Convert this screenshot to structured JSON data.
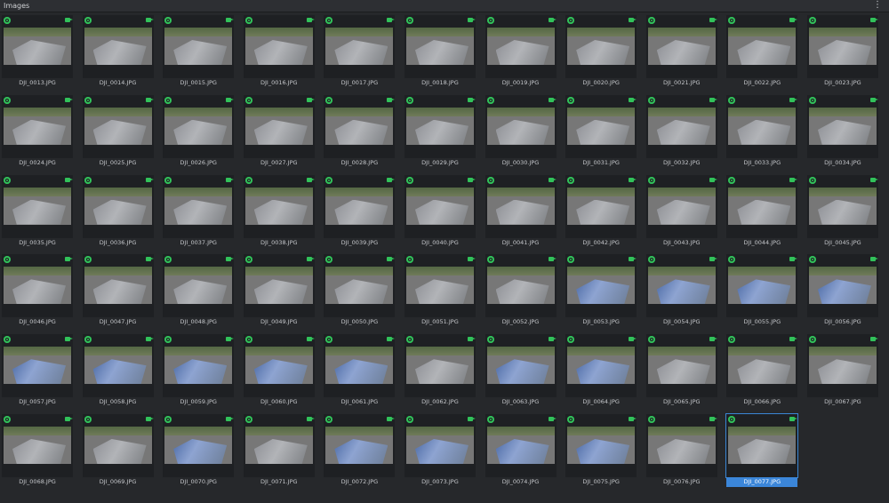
{
  "panel": {
    "title": "Images",
    "menu_icon": "more-vertical-icon",
    "selected_file": "DJI_0077.JPG"
  },
  "images": [
    {
      "label": "DJI_0013.JPG",
      "tone": "gray"
    },
    {
      "label": "DJI_0014.JPG",
      "tone": "gray"
    },
    {
      "label": "DJI_0015.JPG",
      "tone": "gray"
    },
    {
      "label": "DJI_0016.JPG",
      "tone": "gray"
    },
    {
      "label": "DJI_0017.JPG",
      "tone": "gray"
    },
    {
      "label": "DJI_0018.JPG",
      "tone": "gray"
    },
    {
      "label": "DJI_0019.JPG",
      "tone": "gray"
    },
    {
      "label": "DJI_0020.JPG",
      "tone": "gray"
    },
    {
      "label": "DJI_0021.JPG",
      "tone": "gray"
    },
    {
      "label": "DJI_0022.JPG",
      "tone": "gray"
    },
    {
      "label": "DJI_0023.JPG",
      "tone": "gray"
    },
    {
      "label": "DJI_0024.JPG",
      "tone": "gray"
    },
    {
      "label": "DJI_0025.JPG",
      "tone": "gray"
    },
    {
      "label": "DJI_0026.JPG",
      "tone": "gray"
    },
    {
      "label": "DJI_0027.JPG",
      "tone": "gray"
    },
    {
      "label": "DJI_0028.JPG",
      "tone": "gray"
    },
    {
      "label": "DJI_0029.JPG",
      "tone": "gray"
    },
    {
      "label": "DJI_0030.JPG",
      "tone": "gray"
    },
    {
      "label": "DJI_0031.JPG",
      "tone": "gray"
    },
    {
      "label": "DJI_0032.JPG",
      "tone": "gray"
    },
    {
      "label": "DJI_0033.JPG",
      "tone": "gray"
    },
    {
      "label": "DJI_0034.JPG",
      "tone": "gray"
    },
    {
      "label": "DJI_0035.JPG",
      "tone": "gray"
    },
    {
      "label": "DJI_0036.JPG",
      "tone": "gray"
    },
    {
      "label": "DJI_0037.JPG",
      "tone": "gray"
    },
    {
      "label": "DJI_0038.JPG",
      "tone": "gray"
    },
    {
      "label": "DJI_0039.JPG",
      "tone": "gray"
    },
    {
      "label": "DJI_0040.JPG",
      "tone": "gray"
    },
    {
      "label": "DJI_0041.JPG",
      "tone": "gray"
    },
    {
      "label": "DJI_0042.JPG",
      "tone": "gray"
    },
    {
      "label": "DJI_0043.JPG",
      "tone": "gray"
    },
    {
      "label": "DJI_0044.JPG",
      "tone": "gray"
    },
    {
      "label": "DJI_0045.JPG",
      "tone": "gray"
    },
    {
      "label": "DJI_0046.JPG",
      "tone": "gray"
    },
    {
      "label": "DJI_0047.JPG",
      "tone": "gray"
    },
    {
      "label": "DJI_0048.JPG",
      "tone": "gray"
    },
    {
      "label": "DJI_0049.JPG",
      "tone": "gray"
    },
    {
      "label": "DJI_0050.JPG",
      "tone": "gray"
    },
    {
      "label": "DJI_0051.JPG",
      "tone": "gray"
    },
    {
      "label": "DJI_0052.JPG",
      "tone": "gray"
    },
    {
      "label": "DJI_0053.JPG",
      "tone": "blue"
    },
    {
      "label": "DJI_0054.JPG",
      "tone": "blue"
    },
    {
      "label": "DJI_0055.JPG",
      "tone": "blue"
    },
    {
      "label": "DJI_0056.JPG",
      "tone": "blue"
    },
    {
      "label": "DJI_0057.JPG",
      "tone": "blue"
    },
    {
      "label": "DJI_0058.JPG",
      "tone": "blue"
    },
    {
      "label": "DJI_0059.JPG",
      "tone": "blue"
    },
    {
      "label": "DJI_0060.JPG",
      "tone": "blue"
    },
    {
      "label": "DJI_0061.JPG",
      "tone": "blue"
    },
    {
      "label": "DJI_0062.JPG",
      "tone": "gray"
    },
    {
      "label": "DJI_0063.JPG",
      "tone": "blue"
    },
    {
      "label": "DJI_0064.JPG",
      "tone": "blue"
    },
    {
      "label": "DJI_0065.JPG",
      "tone": "gray"
    },
    {
      "label": "DJI_0066.JPG",
      "tone": "gray"
    },
    {
      "label": "DJI_0067.JPG",
      "tone": "gray"
    },
    {
      "label": "DJI_0068.JPG",
      "tone": "gray"
    },
    {
      "label": "DJI_0069.JPG",
      "tone": "gray"
    },
    {
      "label": "DJI_0070.JPG",
      "tone": "blue"
    },
    {
      "label": "DJI_0071.JPG",
      "tone": "gray"
    },
    {
      "label": "DJI_0072.JPG",
      "tone": "blue"
    },
    {
      "label": "DJI_0073.JPG",
      "tone": "blue"
    },
    {
      "label": "DJI_0074.JPG",
      "tone": "blue"
    },
    {
      "label": "DJI_0075.JPG",
      "tone": "blue"
    },
    {
      "label": "DJI_0076.JPG",
      "tone": "gray"
    },
    {
      "label": "DJI_0077.JPG",
      "tone": "gray",
      "selected": true
    }
  ],
  "badges": {
    "left_icon": "gear-icon",
    "right_icon": "video-camera-icon",
    "color": "#31c25a"
  },
  "colors": {
    "background": "#26282b",
    "selection": "#3b86d9"
  }
}
